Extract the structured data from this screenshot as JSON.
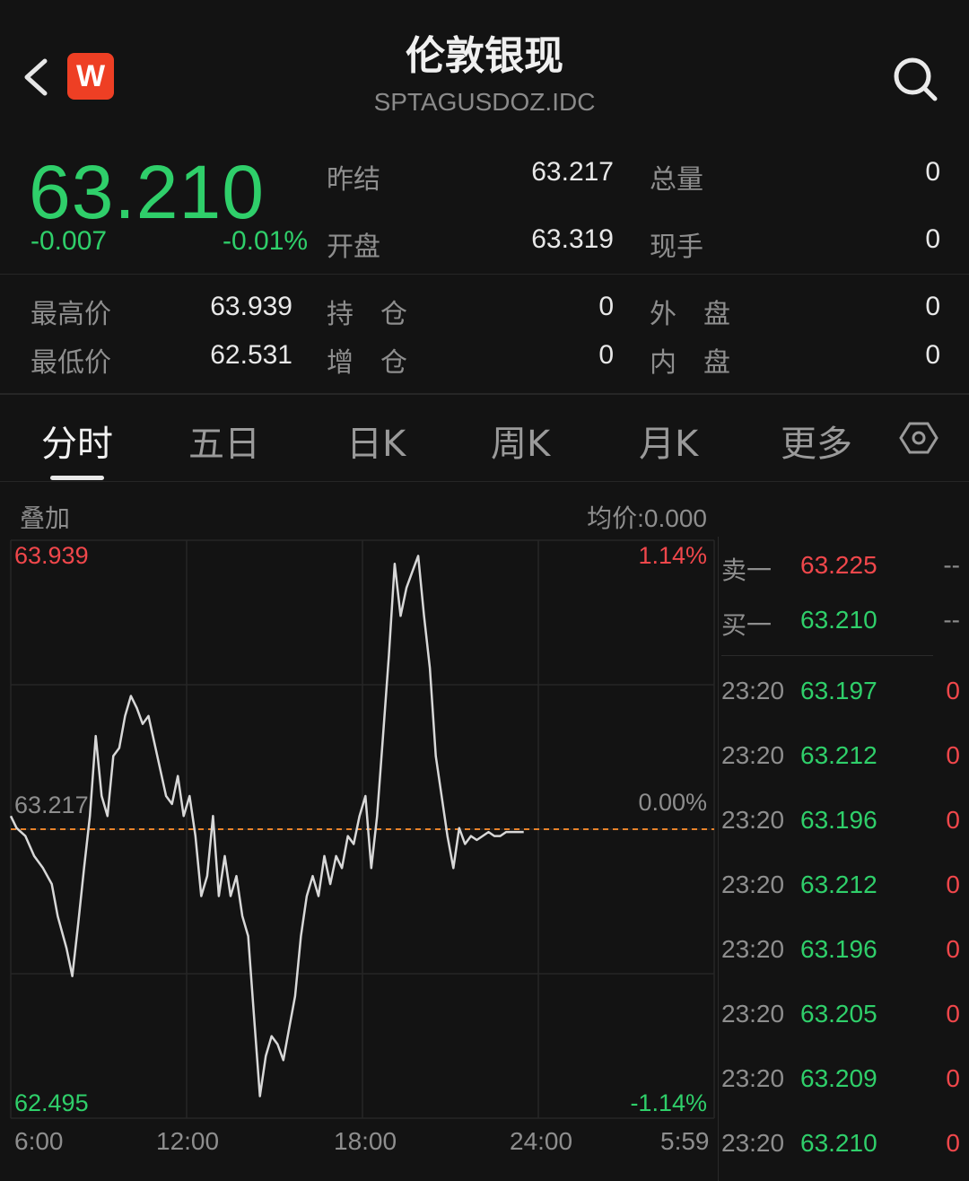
{
  "header": {
    "title": "伦敦银现",
    "subtitle": "SPTAGUSDOZ.IDC",
    "logo_text": "W",
    "back_icon": "chevron-left-icon",
    "search_icon": "search-icon"
  },
  "quote": {
    "price": "63.210",
    "change": "-0.007",
    "change_pct": "-0.01%",
    "fields": {
      "prev_settle_label": "昨结",
      "prev_settle": "63.217",
      "total_vol_label": "总量",
      "total_vol": "0",
      "open_label": "开盘",
      "open": "63.319",
      "cur_hand_label": "现手",
      "cur_hand": "0",
      "high_label": "最高价",
      "high": "63.939",
      "hold_label": "持　仓",
      "hold": "0",
      "outer_label": "外　盘",
      "outer": "0",
      "low_label": "最低价",
      "low": "62.531",
      "inc_label": "增　仓",
      "inc": "0",
      "inner_label": "内　盘",
      "inner": "0"
    }
  },
  "tabs": [
    "分时",
    "五日",
    "日K",
    "周K",
    "月K",
    "更多"
  ],
  "active_tab": "分时",
  "chart_header": {
    "overlay": "叠加",
    "avg": "均价:0.000"
  },
  "chart_data": {
    "type": "line",
    "ylim": [
      62.495,
      63.939
    ],
    "baseline": 63.217,
    "y_labels_left": {
      "top": "63.939",
      "mid": "63.217",
      "bottom": "62.495"
    },
    "y_labels_right": {
      "top": "1.14%",
      "mid": "0.00%",
      "bottom": "-1.14%"
    },
    "x_ticks": [
      "6:00",
      "12:00",
      "18:00",
      "24:00",
      "5:59"
    ],
    "x_hours": [
      0,
      6,
      12,
      18,
      24
    ],
    "series": [
      {
        "x": [
          0,
          0.2,
          0.5,
          0.8,
          1.1,
          1.4,
          1.6,
          1.9,
          2.1,
          2.3,
          2.5,
          2.7,
          2.9,
          3.1,
          3.3,
          3.5,
          3.7,
          3.9,
          4.1,
          4.3,
          4.5,
          4.7,
          5.0,
          5.3,
          5.5,
          5.7,
          5.9,
          6.1,
          6.3,
          6.5,
          6.7,
          6.9,
          7.1,
          7.3,
          7.5,
          7.7,
          7.9,
          8.1,
          8.3,
          8.5,
          8.7,
          8.9,
          9.1,
          9.3,
          9.5,
          9.7,
          9.9,
          10.1,
          10.3,
          10.5,
          10.7,
          10.9,
          11.1,
          11.3,
          11.5,
          11.7,
          11.9,
          12.1,
          12.3,
          12.5,
          12.7,
          12.9,
          13.1,
          13.3,
          13.5,
          13.7,
          13.9,
          14.1,
          14.3,
          14.5,
          14.7,
          14.9,
          15.1,
          15.3,
          15.5,
          15.7,
          15.9,
          16.1,
          16.3,
          16.5,
          16.7,
          16.9,
          17.1,
          17.3,
          17.5
        ],
        "y": [
          63.25,
          63.22,
          63.2,
          63.15,
          63.12,
          63.08,
          63.0,
          62.92,
          62.85,
          62.98,
          63.12,
          63.25,
          63.45,
          63.3,
          63.25,
          63.4,
          63.42,
          63.5,
          63.55,
          63.52,
          63.48,
          63.5,
          63.4,
          63.3,
          63.28,
          63.35,
          63.25,
          63.3,
          63.2,
          63.05,
          63.1,
          63.25,
          63.05,
          63.15,
          63.05,
          63.1,
          63.0,
          62.95,
          62.75,
          62.55,
          62.65,
          62.7,
          62.68,
          62.64,
          62.72,
          62.8,
          62.95,
          63.05,
          63.1,
          63.05,
          63.15,
          63.08,
          63.15,
          63.12,
          63.2,
          63.18,
          63.25,
          63.3,
          63.12,
          63.25,
          63.45,
          63.65,
          63.88,
          63.75,
          63.82,
          63.86,
          63.9,
          63.75,
          63.62,
          63.4,
          63.3,
          63.2,
          63.12,
          63.22,
          63.18,
          63.2,
          63.19,
          63.2,
          63.21,
          63.2,
          63.2,
          63.21,
          63.21,
          63.21,
          63.21
        ]
      }
    ]
  },
  "orderbook": {
    "sell1_label": "卖一",
    "sell1_price": "63.225",
    "sell1_vol": "--",
    "buy1_label": "买一",
    "buy1_price": "63.210",
    "buy1_vol": "--",
    "ticks": [
      {
        "time": "23:20",
        "price": "63.197",
        "vol": "0"
      },
      {
        "time": "23:20",
        "price": "63.212",
        "vol": "0"
      },
      {
        "time": "23:20",
        "price": "63.196",
        "vol": "0"
      },
      {
        "time": "23:20",
        "price": "63.212",
        "vol": "0"
      },
      {
        "time": "23:20",
        "price": "63.196",
        "vol": "0"
      },
      {
        "time": "23:20",
        "price": "63.205",
        "vol": "0"
      },
      {
        "time": "23:20",
        "price": "63.209",
        "vol": "0"
      },
      {
        "time": "23:20",
        "price": "63.210",
        "vol": "0"
      }
    ]
  },
  "colors": {
    "up": "#f0474b",
    "down": "#2fcf6a",
    "line": "#d8d8d8",
    "baseline": "#e8822a"
  }
}
